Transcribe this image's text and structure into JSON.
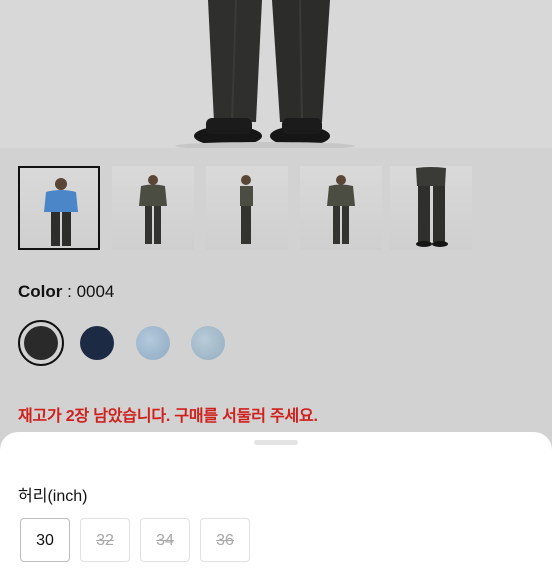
{
  "product": {
    "color_label": "Color",
    "color_separator": " : ",
    "color_value": "0004",
    "swatches": [
      {
        "name": "black",
        "hex": "#2a2a2a",
        "selected": true
      },
      {
        "name": "navy",
        "hex": "#1c2a44",
        "selected": false
      },
      {
        "name": "light-wash",
        "hex": "#9fb8d0",
        "selected": false
      },
      {
        "name": "light-wash-2",
        "hex": "#a6bccb",
        "selected": false
      }
    ],
    "stock_message": "재고가 2장 남았습니다. 구매를 서둘러 주세요."
  },
  "thumbnails": [
    {
      "name": "front-blue-tee",
      "active": true
    },
    {
      "name": "front-dark-tee",
      "active": false
    },
    {
      "name": "side-view",
      "active": false
    },
    {
      "name": "front-view-2",
      "active": false
    },
    {
      "name": "lower-body-view",
      "active": false
    }
  ],
  "size_sheet": {
    "title": "허리(inch)",
    "sizes": [
      {
        "label": "30",
        "available": true
      },
      {
        "label": "32",
        "available": false
      },
      {
        "label": "34",
        "available": false
      },
      {
        "label": "36",
        "available": false
      }
    ]
  },
  "colors": {
    "alert_red": "#d0201c",
    "background": "#d2d2d2",
    "sheet": "#ffffff"
  }
}
